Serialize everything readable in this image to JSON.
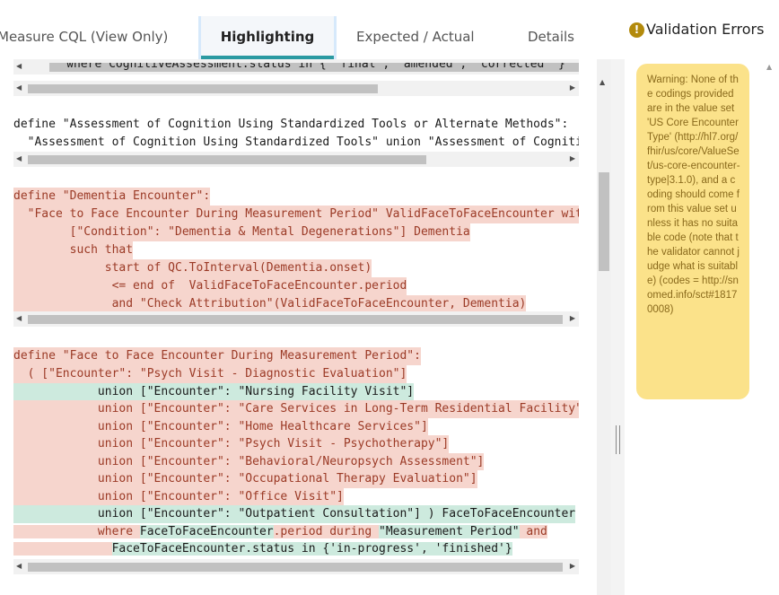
{
  "tabs": [
    {
      "label": "Measure CQL (View Only)",
      "active": false
    },
    {
      "label": "Highlighting",
      "active": true
    },
    {
      "label": "Expected / Actual",
      "active": false
    },
    {
      "label": "Details",
      "active": false
    }
  ],
  "validation": {
    "header": "Validation Errors",
    "icon": "warning-circle-icon",
    "warning": "Warning: None of the codings provided are in the value set 'US Core Encounter Type' (http://hl7.org/fhir/us/core/ValueSet/us-core-encounter-type|3.1.0), and a coding should come from this value set unless it has no suitable code (note that the validator cannot judge what is suitable) (codes = http://snomed.info/sct#18170008)"
  },
  "colors": {
    "accent": "#2a9aa2",
    "red_highlight": "#f6d5cd",
    "green_highlight": "#cdeade",
    "warning_bg": "#fbe28a"
  },
  "code": {
    "block0": [
      "     where CognitiveAssessment.status in { 'final', 'amended', 'corrected' }"
    ],
    "block1": [
      "define \"Assessment of Cognition Using Standardized Tools or Alternate Methods\":",
      "  \"Assessment of Cognition Using Standardized Tools\" union \"Assessment of Cognition Using Alternate Methods\""
    ],
    "block2": [
      "define \"Dementia Encounter\":",
      "  \"Face to Face Encounter During Measurement Period\" ValidFaceToFaceEncounter with",
      "        [\"Condition\": \"Dementia & Mental Degenerations\"] Dementia",
      "        such that",
      "             start of QC.ToInterval(Dementia.onset)",
      "              <= end of  ValidFaceToFaceEncounter.period",
      "              and \"Check Attribution\"(ValidFaceToFaceEncounter, Dementia)"
    ],
    "block3": {
      "header": "define \"Face to Face Encounter During Measurement Period\":",
      "first": "  ( [\"Encounter\": \"Psych Visit - Diagnostic Evaluation\"]",
      "unions": [
        "            union [\"Encounter\": \"Nursing Facility Visit\"]",
        "            union [\"Encounter\": \"Care Services in Long-Term Residential Facility\"]",
        "            union [\"Encounter\": \"Home Healthcare Services\"]",
        "            union [\"Encounter\": \"Psych Visit - Psychotherapy\"]",
        "            union [\"Encounter\": \"Behavioral/Neuropsych Assessment\"]",
        "            union [\"Encounter\": \"Occupational Therapy Evaluation\"]",
        "            union [\"Encounter\": \"Office Visit\"]"
      ],
      "last_union_green": "            union [\"Encounter\": \"Outpatient Consultation\"] ) FaceToFaceEncounter",
      "where_pre": "            where ",
      "where_g1": "FaceToFaceEncounter",
      "where_mid": ".period during ",
      "where_g2": "\"Measurement Period\"",
      "where_post": " and",
      "status_pre": "              ",
      "status_g": "FaceToFaceEncounter.status in {'in-progress', 'finished'}"
    }
  }
}
